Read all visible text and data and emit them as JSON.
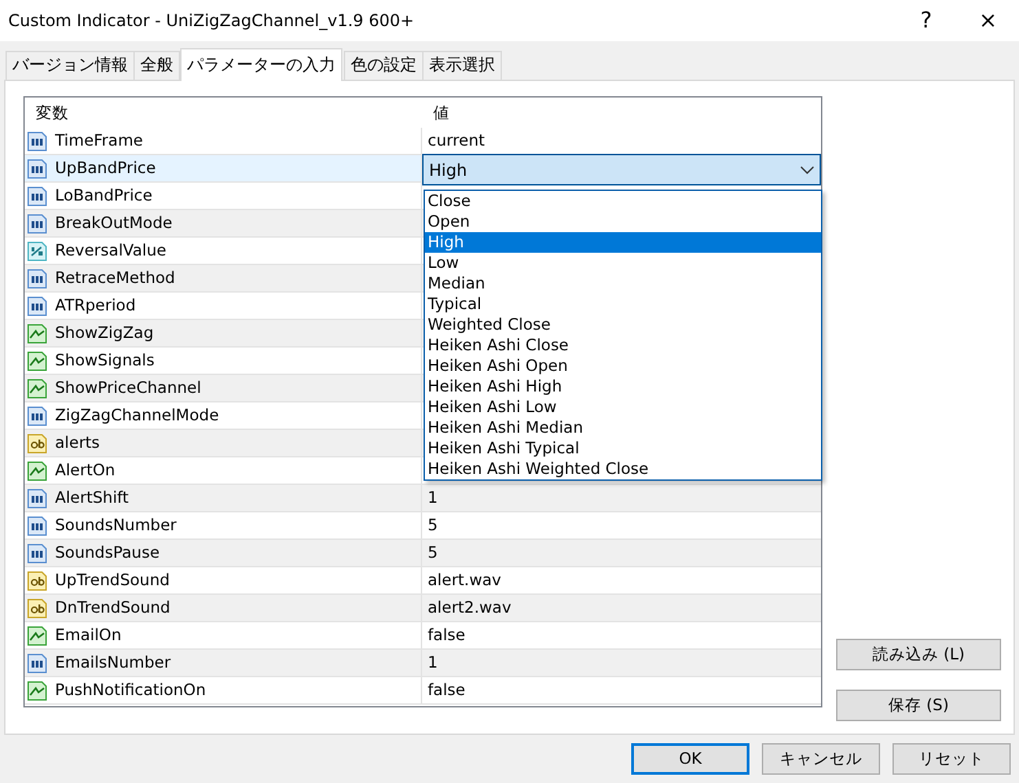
{
  "window": {
    "title": "Custom Indicator - UniZigZagChannel_v1.9 600+",
    "help_button": "?",
    "close_button": "×"
  },
  "tabs": [
    {
      "label": "バージョン情報",
      "selected": false
    },
    {
      "label": "全般",
      "selected": false
    },
    {
      "label": "パラメーターの入力",
      "selected": true
    },
    {
      "label": "色の設定",
      "selected": false
    },
    {
      "label": "表示選択",
      "selected": false
    }
  ],
  "table": {
    "columns": [
      "変数",
      "値"
    ],
    "rows": [
      {
        "kind": "int",
        "name": "TimeFrame",
        "value": "current",
        "selected": false
      },
      {
        "kind": "int",
        "name": "UpBandPrice",
        "value": "High",
        "selected": true,
        "options": [
          {
            "label": "Close",
            "selected": false
          },
          {
            "label": "Open",
            "selected": false
          },
          {
            "label": "High",
            "selected": true
          },
          {
            "label": "Low",
            "selected": false
          },
          {
            "label": "Median",
            "selected": false
          },
          {
            "label": "Typical",
            "selected": false
          },
          {
            "label": "Weighted Close",
            "selected": false
          },
          {
            "label": "Heiken Ashi Close",
            "selected": false
          },
          {
            "label": "Heiken Ashi Open",
            "selected": false
          },
          {
            "label": "Heiken Ashi High",
            "selected": false
          },
          {
            "label": "Heiken Ashi Low",
            "selected": false
          },
          {
            "label": "Heiken Ashi Median",
            "selected": false
          },
          {
            "label": "Heiken Ashi Typical",
            "selected": false
          },
          {
            "label": "Heiken Ashi Weighted Close",
            "selected": false
          }
        ]
      },
      {
        "kind": "int",
        "name": "LoBandPrice",
        "selected": false
      },
      {
        "kind": "int",
        "name": "BreakOutMode",
        "selected": false
      },
      {
        "kind": "double",
        "name": "ReversalValue",
        "selected": false
      },
      {
        "kind": "int",
        "name": "RetraceMethod",
        "selected": false
      },
      {
        "kind": "int",
        "name": "ATRperiod",
        "selected": false
      },
      {
        "kind": "bool",
        "name": "ShowZigZag",
        "selected": false
      },
      {
        "kind": "bool",
        "name": "ShowSignals",
        "selected": false
      },
      {
        "kind": "bool",
        "name": "ShowPriceChannel",
        "selected": false
      },
      {
        "kind": "int",
        "name": "ZigZagChannelMode",
        "selected": false
      },
      {
        "kind": "string",
        "name": "alerts",
        "selected": false
      },
      {
        "kind": "bool",
        "name": "AlertOn",
        "selected": false
      },
      {
        "kind": "int",
        "name": "AlertShift",
        "value": "1",
        "selected": false
      },
      {
        "kind": "int",
        "name": "SoundsNumber",
        "value": "5",
        "selected": false
      },
      {
        "kind": "int",
        "name": "SoundsPause",
        "value": "5",
        "selected": false
      },
      {
        "kind": "string",
        "name": "UpTrendSound",
        "value": "alert.wav",
        "selected": false
      },
      {
        "kind": "string",
        "name": "DnTrendSound",
        "value": "alert2.wav",
        "selected": false
      },
      {
        "kind": "bool",
        "name": "EmailOn",
        "value": "false",
        "selected": false
      },
      {
        "kind": "int",
        "name": "EmailsNumber",
        "value": "1",
        "selected": false
      },
      {
        "kind": "bool",
        "name": "PushNotificationOn",
        "value": "false",
        "selected": false
      }
    ]
  },
  "side_buttons": [
    "読み込み (L)",
    "保存 (S)"
  ],
  "footer_buttons": [
    {
      "label": "OK",
      "default": true
    },
    {
      "label": "キャンセル",
      "default": false
    },
    {
      "label": "リセット",
      "default": false
    }
  ]
}
